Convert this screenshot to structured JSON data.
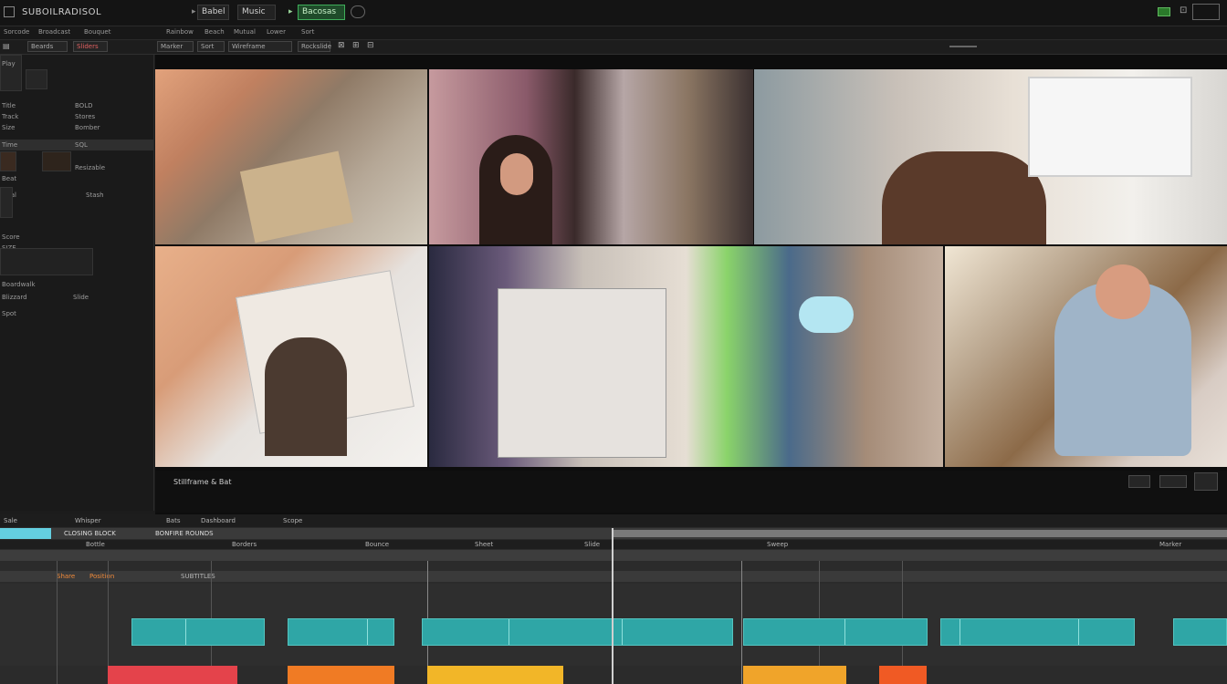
{
  "titlebar": {
    "app_title": "SUBOILRADISOL",
    "tab_a": "Babel",
    "tab_b": "Music",
    "badge": "Bacosas"
  },
  "toolbar": {
    "items": [
      "Sorcode",
      "Broadcast",
      "Bouquet",
      "Rainbow",
      "Beach",
      "Mutual",
      "Lower",
      "Sort"
    ]
  },
  "toolbar2": {
    "items": [
      "Beards",
      "Sliders",
      "Marker",
      "Sort",
      "Wireframe",
      "Rockslide"
    ]
  },
  "left_panel": {
    "header": "Play",
    "rows": [
      {
        "label": "Title",
        "value": "BOLD"
      },
      {
        "label": "Track",
        "value": "Stores"
      },
      {
        "label": "Size",
        "value": "Bomber"
      },
      {
        "label": "Time",
        "value": "SQL"
      },
      {
        "label": "Beat",
        "value": "Resizable"
      },
      {
        "label": "Goal",
        "value": "Stash"
      },
      {
        "label": "Score",
        "value": "SIZE"
      }
    ],
    "footer_a": "Boardwalk",
    "footer_b": "Blizzard",
    "footer_c": "Slide",
    "footer_d": "Spot"
  },
  "viewer": {
    "caption": "Stillframe & Bat",
    "colors": {
      "t1": "#a9917a",
      "t2": "#b08c86",
      "t3": "#bfb7ad",
      "t4": "#c7b49c",
      "t5": "#8a6a66",
      "t6": "#9c7f6a"
    }
  },
  "timeline": {
    "tabs": [
      "Sale",
      "Whisper",
      "Bats",
      "Dashboard",
      "Scope"
    ],
    "ruler_labels": [
      "CLOSING BLOCK",
      "BONFIRE ROUNDS"
    ],
    "track_labels": [
      "Share",
      "Position",
      "SUBTITLES"
    ],
    "marker_labels": [
      "Bottle",
      "Borders",
      "Bounce",
      "Sheet",
      "Slide",
      "Sweep",
      "Marker"
    ],
    "colors": {
      "clip": "#2fa6a6",
      "red": "#e4434b",
      "orange": "#f07b24",
      "yellow": "#f2b628"
    }
  }
}
